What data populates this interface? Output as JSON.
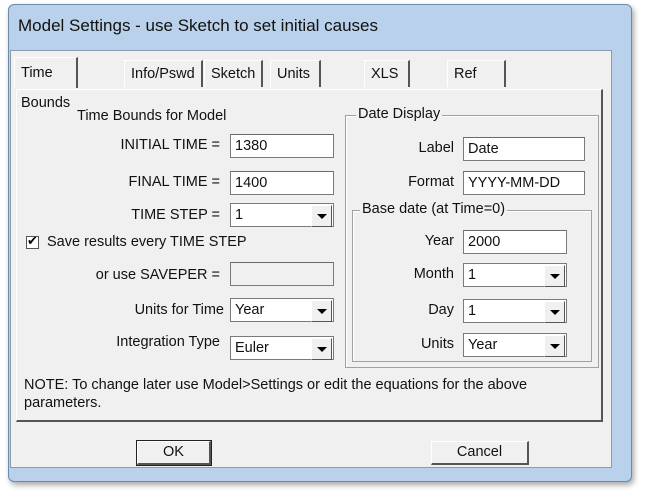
{
  "window": {
    "title": "Model Settings - use Sketch to set initial causes"
  },
  "tabs": [
    {
      "label": "Time Bounds",
      "active": true
    },
    {
      "label": "Info/Pswd"
    },
    {
      "label": "Sketch"
    },
    {
      "label": "Units Equiv"
    },
    {
      "label": "XLS Files"
    },
    {
      "label": "Ref Modes"
    }
  ],
  "time_bounds": {
    "heading": "Time Bounds for Model",
    "initial_time_label": "INITIAL TIME =",
    "initial_time_value": "1380",
    "final_time_label": "FINAL TIME =",
    "final_time_value": "1400",
    "time_step_label": "TIME STEP =",
    "time_step_value": "1",
    "save_checkbox_label": "Save results every TIME STEP",
    "save_checked": true,
    "saveper_label": "or use SAVEPER =",
    "saveper_value": "",
    "units_for_time_label": "Units for Time",
    "units_for_time_value": "Year",
    "integration_type_label": "Integration Type",
    "integration_type_value": "Euler"
  },
  "date_display": {
    "title": "Date Display",
    "label_label": "Label",
    "label_value": "Date",
    "format_label": "Format",
    "format_value": "YYYY-MM-DD",
    "base_date": {
      "title": "Base date (at Time=0)",
      "year_label": "Year",
      "year_value": "2000",
      "month_label": "Month",
      "month_value": "1",
      "day_label": "Day",
      "day_value": "1",
      "units_label": "Units",
      "units_value": "Year"
    }
  },
  "note": "NOTE:  To change later use Model>Settings or edit the equations for the above parameters.",
  "buttons": {
    "ok": "OK",
    "cancel": "Cancel"
  }
}
